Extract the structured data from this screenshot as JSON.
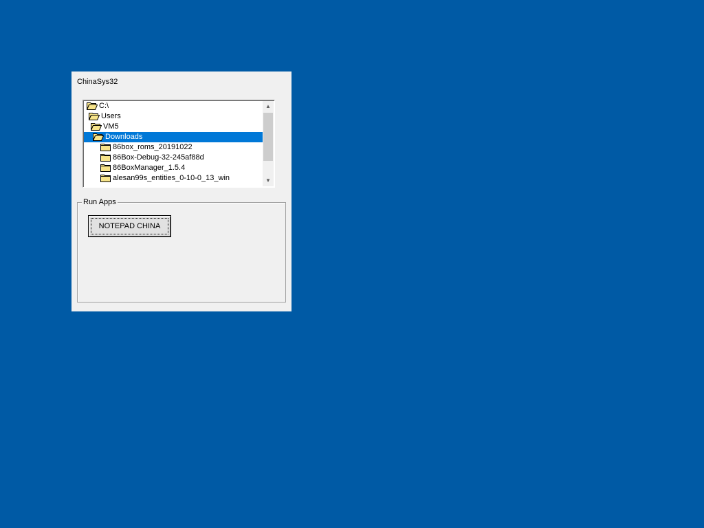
{
  "app": {
    "title": "ChinaSys32"
  },
  "directory_list": {
    "items": [
      {
        "label": "C:\\",
        "icon": "open-folder-icon",
        "indent": 0,
        "selected": false
      },
      {
        "label": "Users",
        "icon": "open-folder-icon",
        "indent": 1,
        "selected": false
      },
      {
        "label": "VM5",
        "icon": "open-folder-icon",
        "indent": 2,
        "selected": false
      },
      {
        "label": "Downloads",
        "icon": "open-folder-icon",
        "indent": 3,
        "selected": true
      },
      {
        "label": "86box_roms_20191022",
        "icon": "folder-icon",
        "indent": 4,
        "selected": false
      },
      {
        "label": "86Box-Debug-32-245af88d",
        "icon": "folder-icon",
        "indent": 4,
        "selected": false
      },
      {
        "label": "86BoxManager_1.5.4",
        "icon": "folder-icon",
        "indent": 4,
        "selected": false
      },
      {
        "label": "alesan99s_entities_0-10-0_13_win",
        "icon": "folder-icon",
        "indent": 4,
        "selected": false
      }
    ]
  },
  "run_apps": {
    "group_label": "Run Apps",
    "notepad_button_label": "NOTEPAD CHINA"
  },
  "colors": {
    "desktop": "#005aa5",
    "window_face": "#f0f0f0",
    "selection": "#0078d7",
    "folder_fill": "#f7e48a",
    "folder_stroke": "#000000"
  }
}
